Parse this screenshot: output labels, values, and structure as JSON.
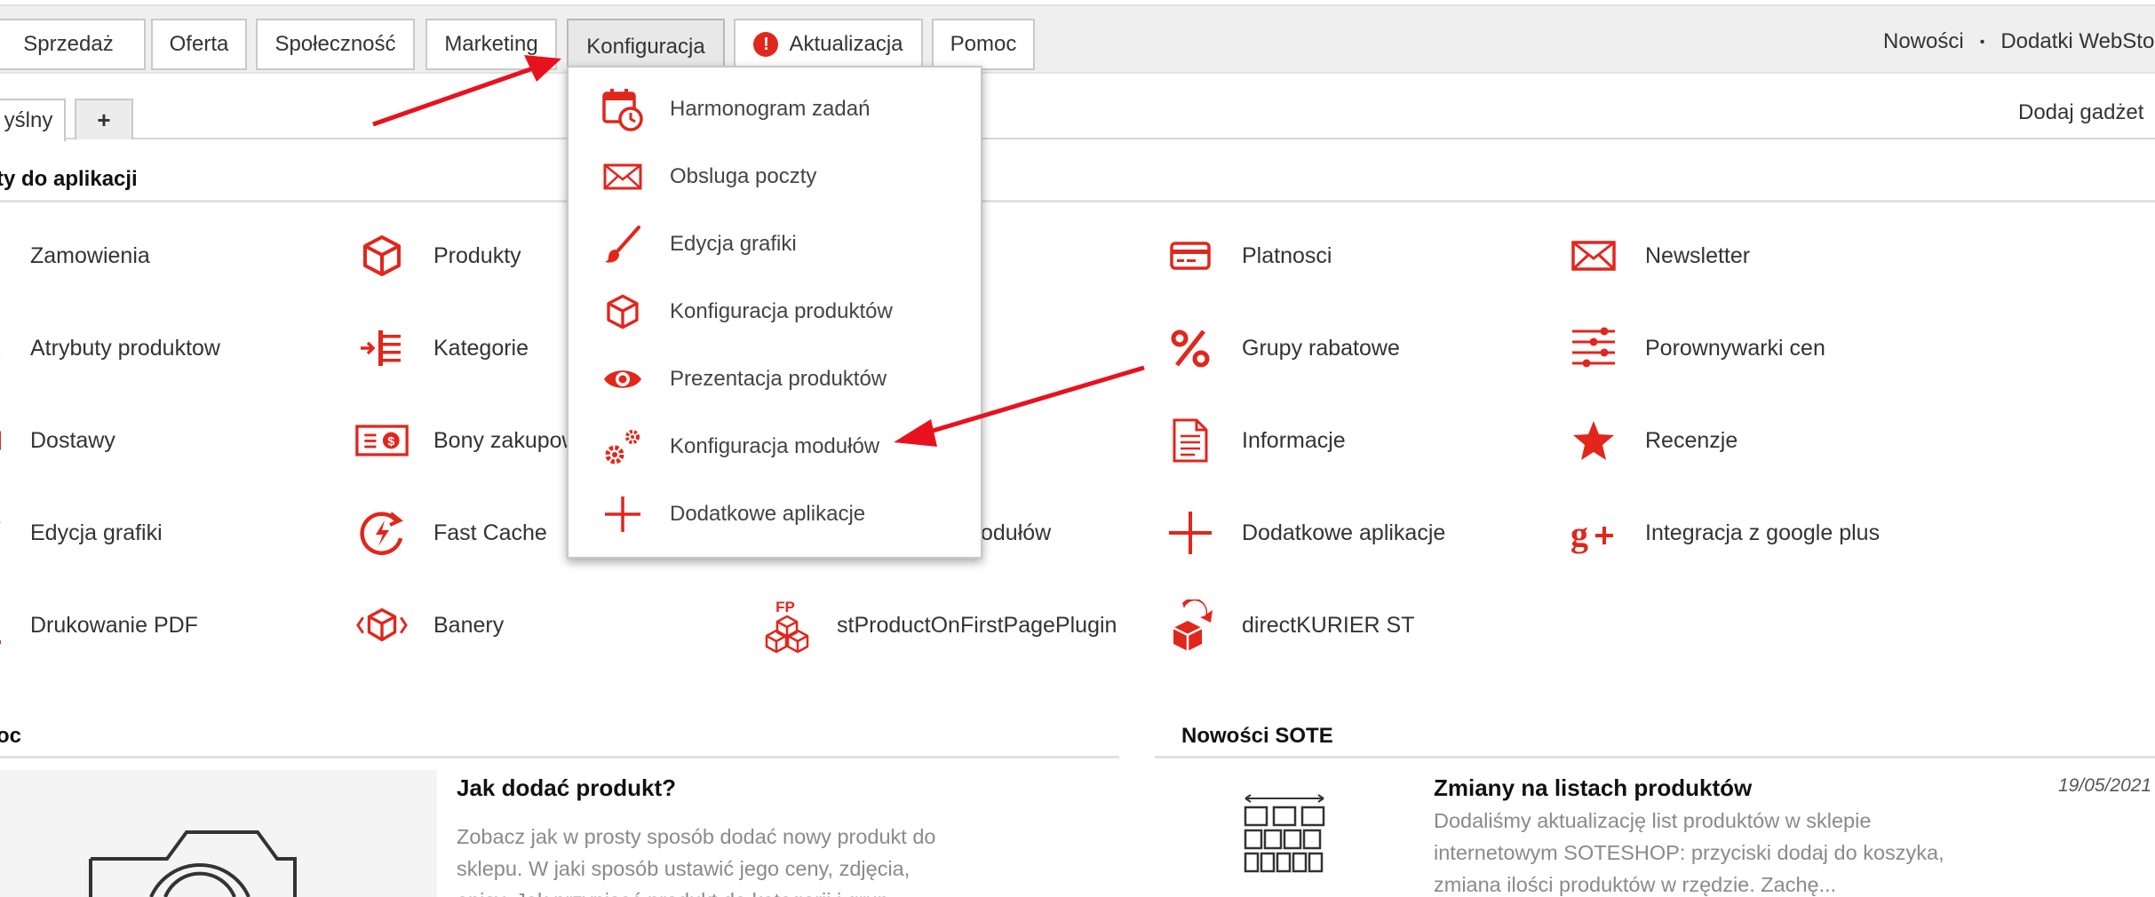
{
  "colors": {
    "accent": "#e1261c",
    "nav_bg": "#efefef",
    "muted_text": "#8a8a8a",
    "annotation_arrow": "#e8121e"
  },
  "nav": {
    "items": [
      {
        "label": "Sprzedaż"
      },
      {
        "label": "Oferta"
      },
      {
        "label": "Społeczność"
      },
      {
        "label": "Marketing"
      },
      {
        "label": "Konfiguracja"
      },
      {
        "label": "Aktualizacja",
        "badge": "!"
      },
      {
        "label": "Pomoc"
      }
    ],
    "right": {
      "news": "Nowości",
      "separator": "•",
      "addons": "Dodatki WebSto"
    }
  },
  "tabs": {
    "default_label": "yślny",
    "add_label": "+",
    "add_gadget": "Dodaj gadżet"
  },
  "shortcuts": {
    "title": "ty do aplikacji",
    "items": [
      {
        "label": "Zamowienia",
        "icon": "cart-icon"
      },
      {
        "label": "Produkty",
        "icon": "box-icon"
      },
      {
        "label": "Platnosci",
        "icon": "card-icon"
      },
      {
        "label": "Newsletter",
        "icon": "envelope-icon"
      },
      {
        "label": "Atrybuty produktow",
        "icon": "attributes-icon"
      },
      {
        "label": "Kategorie",
        "icon": "category-list-icon"
      },
      {
        "label": "Grupy rabatowe",
        "icon": "percent-icon"
      },
      {
        "label": "Porownywarki cen",
        "icon": "sliders-icon"
      },
      {
        "label": "Dostawy",
        "icon": "truck-icon"
      },
      {
        "label": "Bony zakupow",
        "icon": "voucher-icon"
      },
      {
        "label": "Informacje",
        "icon": "document-icon"
      },
      {
        "label": "Recenzje",
        "icon": "star-icon"
      },
      {
        "label": "Edycja grafiki",
        "icon": "brush-icon"
      },
      {
        "label": "Fast Cache",
        "icon": "fast-cache-icon"
      },
      {
        "label": "odułów",
        "icon": "gears-icon"
      },
      {
        "label": "Dodatkowe aplikacje",
        "icon": "plus-icon"
      },
      {
        "label": "Integracja z google plus",
        "icon": "google-plus-icon"
      },
      {
        "label": "Drukowanie PDF",
        "icon": "pdf-icon"
      },
      {
        "label": "Banery",
        "icon": "banner-box-icon"
      },
      {
        "label": "stProductOnFirstPagePlugin",
        "icon": "first-page-boxes-icon"
      },
      {
        "label": "directKURIER ST",
        "icon": "courier-package-icon"
      }
    ]
  },
  "dropdown": {
    "items": [
      {
        "label": "Harmonogram zadań",
        "icon": "calendar-clock-icon"
      },
      {
        "label": "Obsluga poczty",
        "icon": "envelope-icon"
      },
      {
        "label": "Edycja grafiki",
        "icon": "brush-icon"
      },
      {
        "label": "Konfiguracja produktów",
        "icon": "box-icon"
      },
      {
        "label": "Prezentacja produktów",
        "icon": "eye-icon"
      },
      {
        "label": "Konfiguracja modułów",
        "icon": "gears-icon"
      },
      {
        "label": "Dodatkowe aplikacje",
        "icon": "plus-icon"
      }
    ]
  },
  "help": {
    "title": "oc",
    "article": {
      "title": "Jak dodać produkt?",
      "line1": "Zobacz jak w prosty sposób dodać nowy produkt do",
      "line2": "sklepu. W jaki sposób ustawić jego ceny, zdjęcia,",
      "line3": "opisy. Jak przypisać produkt do kategorii i grup"
    }
  },
  "news": {
    "title": "Nowości SOTE",
    "article": {
      "title": "Zmiany na listach produktów",
      "date": "19/05/2021",
      "line1": "Dodaliśmy aktualizację list produktów w sklepie",
      "line2": "internetowym SOTESHOP: przyciski dodaj do koszyka,",
      "line3": "zmiana ilości produktów w rzędzie. Zachę..."
    }
  }
}
